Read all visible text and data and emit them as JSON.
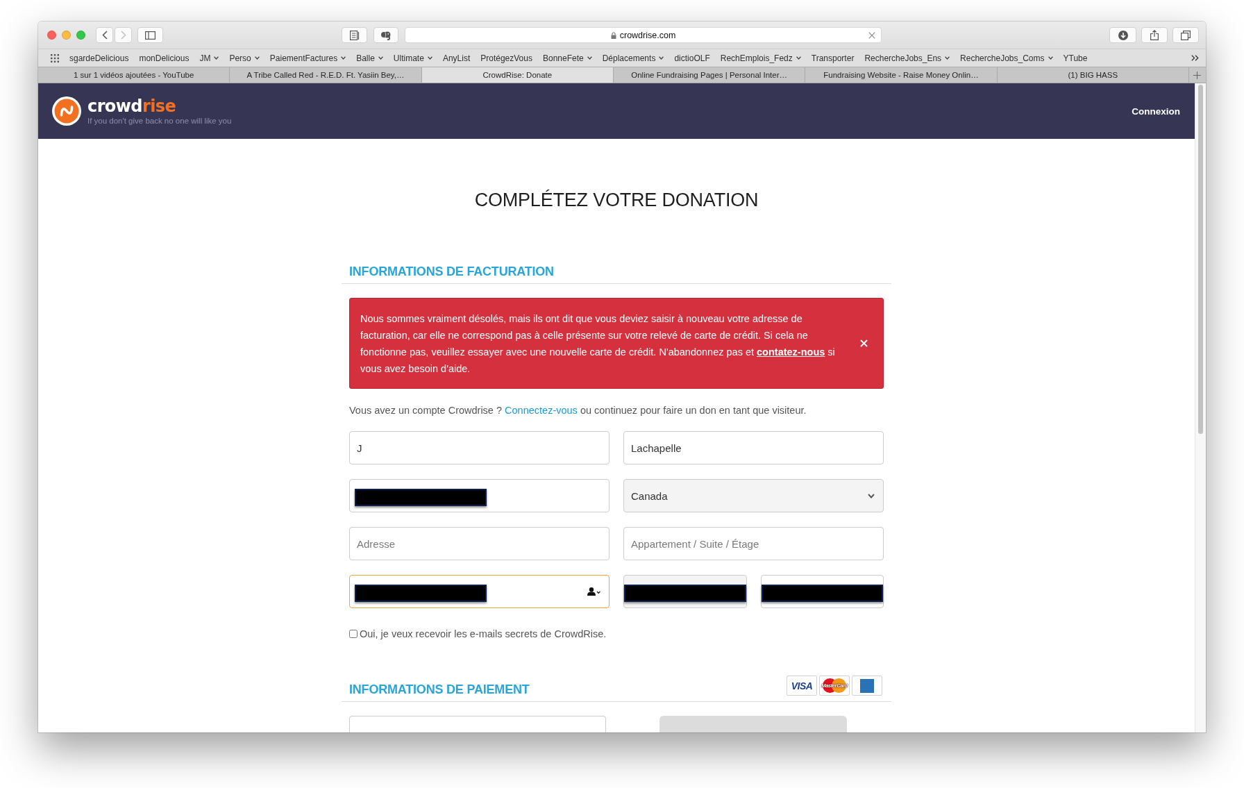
{
  "browser": {
    "nav_buttons": [
      {
        "kind": "back",
        "disabled": false
      },
      {
        "kind": "forward",
        "disabled": true
      }
    ],
    "url": "crowdrise.com",
    "bookmarks": [
      {
        "label": "sgardeDelicious",
        "menu": false
      },
      {
        "label": "monDelicious",
        "menu": false
      },
      {
        "label": "JM",
        "menu": true
      },
      {
        "label": "Perso",
        "menu": true
      },
      {
        "label": "PaiementFactures",
        "menu": true
      },
      {
        "label": "Balle",
        "menu": true
      },
      {
        "label": "Ultimate",
        "menu": true
      },
      {
        "label": "AnyList",
        "menu": false
      },
      {
        "label": "ProtégezVous",
        "menu": false
      },
      {
        "label": "BonneFete",
        "menu": true
      },
      {
        "label": "Déplacements",
        "menu": true
      },
      {
        "label": "dictioOLF",
        "menu": false
      },
      {
        "label": "RechEmplois_Fedz",
        "menu": true
      },
      {
        "label": "Transporter",
        "menu": false
      },
      {
        "label": "RechercheJobs_Ens",
        "menu": true
      },
      {
        "label": "RechercheJobs_Coms",
        "menu": true
      },
      {
        "label": "YTube",
        "menu": false
      }
    ],
    "tabs": [
      {
        "title": "1 sur 1 vidéos ajoutées - YouTube",
        "selected": false
      },
      {
        "title": "A Tribe Called Red - R.E.D. Ft. Yasiin Bey,…",
        "selected": false
      },
      {
        "title": "CrowdRise: Donate",
        "selected": true
      },
      {
        "title": "Online Fundraising Pages | Personal Inter…",
        "selected": false
      },
      {
        "title": "Fundraising Website - Raise Money Onlin…",
        "selected": false
      },
      {
        "title": "(1) BIG HASS",
        "selected": false
      }
    ]
  },
  "site_header": {
    "wordmark": [
      "crowd",
      "rise"
    ],
    "tagline": "If you don't give back no one will like you",
    "login": "Connexion"
  },
  "page_title": "COMPLÉTEZ VOTRE DONATION",
  "billing": {
    "heading": "INFORMATIONS DE FACTURATION",
    "alert": {
      "text_before": "Nous sommes vraiment désolés, mais ils ont dit que vous deviez saisir à nouveau votre adresse de facturation, car elle ne correspond pas à celle présente sur votre relevé de carte de crédit. Si cela ne fonctionne pas, veuillez essayer avec une nouvelle carte de crédit. N'abandonnez pas et",
      "link": "contatez-nous",
      "text_after": "si vous avez besoin d'aide."
    },
    "account_prompt": {
      "text_before": "Vous avez un compte Crowdrise ?",
      "link": "Connectez-vous",
      "text_after": "ou continuez pour faire un don en tant que visiteur."
    },
    "field_rows": [
      [
        {
          "kind": "text",
          "value": "J",
          "redacted": false,
          "focused": false
        },
        {
          "kind": "text",
          "value": "Lachapelle",
          "redacted": false,
          "focused": false
        }
      ],
      [
        {
          "kind": "text",
          "redacted": true,
          "focused": false
        },
        {
          "kind": "select",
          "value": "Canada",
          "redacted": false,
          "focused": false
        }
      ],
      [
        {
          "kind": "text",
          "placeholder": "Adresse",
          "redacted": false,
          "focused": false
        },
        {
          "kind": "text",
          "placeholder": "Appartement / Suite / Étage",
          "redacted": false,
          "focused": false
        }
      ],
      [
        {
          "kind": "contact",
          "redacted": true,
          "focused": true
        },
        {
          "kind": "select",
          "redacted": true,
          "focused": false
        },
        {
          "kind": "text",
          "redacted": true,
          "focused": false
        }
      ]
    ],
    "newsletter": {
      "label": "Oui, je veux recevoir les e-mails secrets de CrowdRise.",
      "checked": false
    }
  },
  "payment": {
    "heading": "INFORMATIONS DE PAIEMENT",
    "cards": [
      {
        "kind": "visa",
        "label": "VISA"
      },
      {
        "kind": "mastercard",
        "label": "MasterCard"
      },
      {
        "kind": "amex"
      }
    ]
  }
}
